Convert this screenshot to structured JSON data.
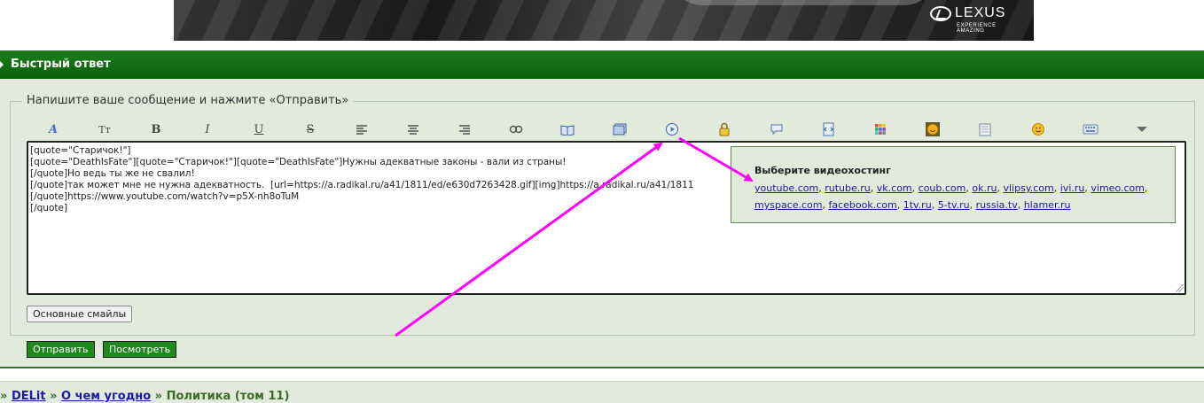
{
  "banner": {
    "brand": "LEXUS",
    "tagline": "EXPERIENCE AMAZING"
  },
  "header": {
    "title": "Быстрый ответ"
  },
  "form": {
    "legend": "Напишите ваше сообщение и нажмите «Отправить»",
    "editor_lines": [
      "[quote=\"Старичок!\"]",
      "[quote=\"DeathIsFate\"][quote=\"Старичок!\"][quote=\"DeathIsFate\"]Нужны адекватные законы - вали из страны!",
      "[/quote]Но ведь ты же не свалил!",
      "[/quote]так может мне не нужна адекватность.  [url=https://a.radikal.ru/a41/1811/ed/e630d7263428.gif][img]https://a.radikal.ru/a41/1811",
      "[/quote]https://www.youtube.com/watch?v=p5X-nh8oTuM",
      "",
      "[/quote]"
    ],
    "smileys_button": "Основные смайлы",
    "send_button": "Отправить",
    "preview_button": "Посмотреть"
  },
  "toolbar": {
    "font": "A",
    "size": "Tт",
    "bold": "B",
    "italic": "I",
    "underline": "U",
    "strike": "S"
  },
  "video_popup": {
    "title": "Выберите видеохостинг",
    "hosts": [
      "youtube.com",
      "rutube.ru",
      "vk.com",
      "coub.com",
      "ok.ru",
      "vlipsy.com",
      "ivi.ru",
      "vimeo.com",
      "myspace.com",
      "facebook.com",
      "1tv.ru",
      "5-tv.ru",
      "russia.tv",
      "hlamer.ru"
    ]
  },
  "breadcrumb": {
    "prefix": "»",
    "forum": "DELit",
    "sep1": "»",
    "section": "О чем угодно",
    "sep2": "»",
    "topic": "Политика (том 11)"
  },
  "colors": {
    "header_green": "#0a5f0a",
    "panel_bg": "#e1eadb",
    "link_blue": "#1a1aa6",
    "arrow_magenta": "#ff00ff",
    "send_green": "#1e8a1e"
  }
}
